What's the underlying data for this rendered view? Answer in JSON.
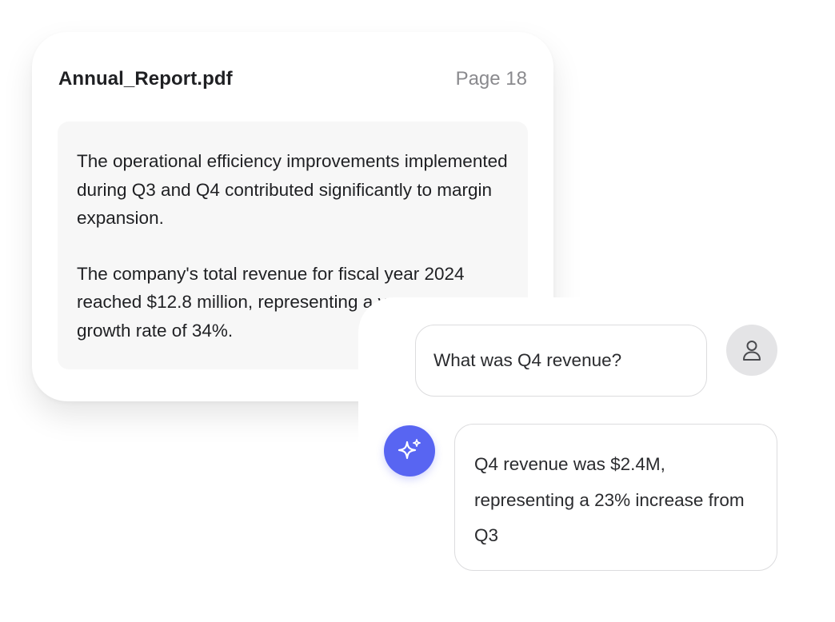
{
  "document": {
    "filename": "Annual_Report.pdf",
    "page_label": "Page 18",
    "paragraphs": [
      "The operational efficiency improvements implemented during Q3 and Q4 contributed significantly to margin expansion.",
      "The company's total revenue for fiscal year 2024 reached $12.8 million, representing a year-over-year growth rate of 34%."
    ]
  },
  "chat": {
    "user_message": "What was Q4 revenue?",
    "assistant_message": "Q4 revenue was $2.4M, representing a 23% increase from Q3",
    "user_avatar_icon": "user-icon",
    "assistant_icon": "sparkle-icon",
    "accent_color": "#5865f2"
  }
}
